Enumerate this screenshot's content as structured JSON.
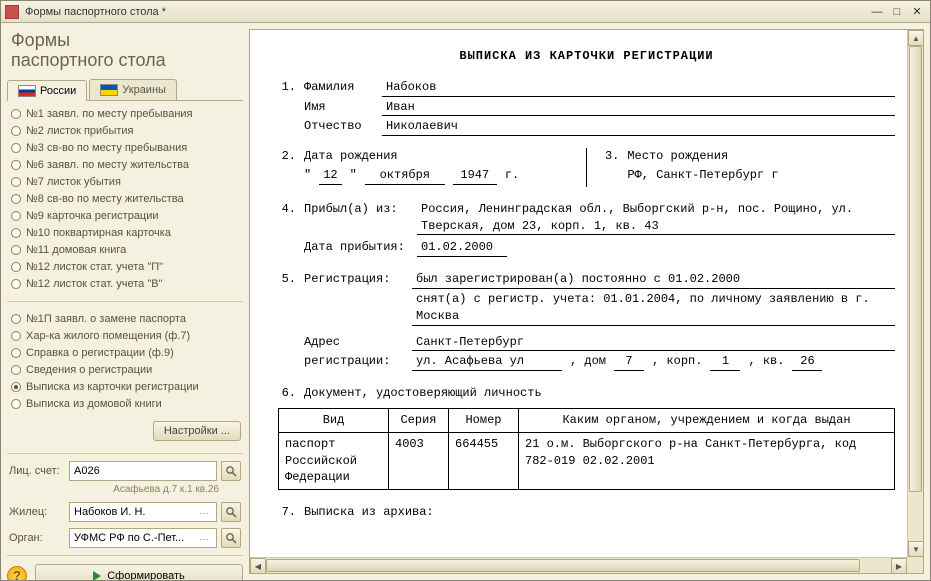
{
  "window": {
    "title": "Формы паспортного стола *"
  },
  "panel": {
    "title_line1": "Формы",
    "title_line2": "паспортного стола",
    "tabs": {
      "ru": "России",
      "ua": "Украины"
    },
    "forms_group1": [
      "№1 заявл. по месту пребывания",
      "№2 листок прибытия",
      "№3 св-во по месту пребывания",
      "№6 заявл. по месту жительства",
      "№7 листок убытия",
      "№8 св-во по месту жительства",
      "№9 карточка регистрации",
      "№10 поквартирная карточка",
      "№11 домовая книга",
      "№12 листок стат. учета \"П\"",
      "№12 листок стат. учета \"В\""
    ],
    "forms_group2": [
      {
        "label": "№1П заявл. о замене паспорта",
        "checked": false
      },
      {
        "label": "Хар-ка жилого помещения (ф.7)",
        "checked": false
      },
      {
        "label": "Справка о регистрации (ф.9)",
        "checked": false
      },
      {
        "label": "Сведения о регистрации",
        "checked": false
      },
      {
        "label": "Выписка из карточки регистрации",
        "checked": true
      },
      {
        "label": "Выписка из домовой книги",
        "checked": false
      }
    ],
    "settings_btn": "Настройки ...",
    "labels": {
      "account": "Лиц. счет:",
      "tenant": "Жилец:",
      "organ": "Орган:"
    },
    "account_value": "А026",
    "account_hint": "Асафьева д.7 к.1 кв.26",
    "tenant_value": "Набоков И. Н.",
    "organ_value": "УФМС РФ по С.-Пет...",
    "form_btn": "Сформировать"
  },
  "doc": {
    "title": "ВЫПИСКА ИЗ КАРТОЧКИ РЕГИСТРАЦИИ",
    "surname_label": "Фамилия",
    "surname": "Набоков",
    "name_label": "Имя",
    "name": "Иван",
    "patronymic_label": "Отчество",
    "patronymic": "Николаевич",
    "dob_label": "Дата рождения",
    "dob_day": "12",
    "dob_month": "октября",
    "dob_year": "1947",
    "dob_year_suffix": "г.",
    "pob_label": "Место рождения",
    "pob": "РФ, Санкт-Петербург г",
    "arrived_label": "Прибыл(а) из:",
    "arrived": "Россия, Ленинградская обл., Выборгский р-н, пос. Рощино, ул. Тверская, дом 23, корп. 1, кв. 43",
    "arrive_date_label": "Дата прибытия:",
    "arrive_date": "01.02.2000",
    "reg_label": "Регистрация:",
    "reg_line1": "был зарегистрирован(а) постоянно с 01.02.2000",
    "reg_line2": "снят(а) с регистр. учета: 01.01.2004, по личному заявлению в г. Москва",
    "addr_label1": "Адрес",
    "addr_label2": "регистрации:",
    "addr_city": "Санкт-Петербург",
    "addr_street": "ул. Асафьева ул",
    "addr_house_label": ", дом",
    "addr_house": "7",
    "addr_korp_label": ", корп.",
    "addr_korp": "1",
    "addr_flat_label": ", кв.",
    "addr_flat": "26",
    "doc_section": "Документ, удостоверяющий личность",
    "table_headers": {
      "kind": "Вид",
      "series": "Серия",
      "number": "Номер",
      "issued": "Каким органом, учреждением и когда выдан"
    },
    "table_row": {
      "kind": "паспорт Российской Федерации",
      "series": "4003",
      "number": "664455",
      "issued": "21 о.м. Выборгского р-на Санкт-Петербурга, код 782-019 02.02.2001"
    },
    "archive_label": "Выписка из архива:"
  }
}
